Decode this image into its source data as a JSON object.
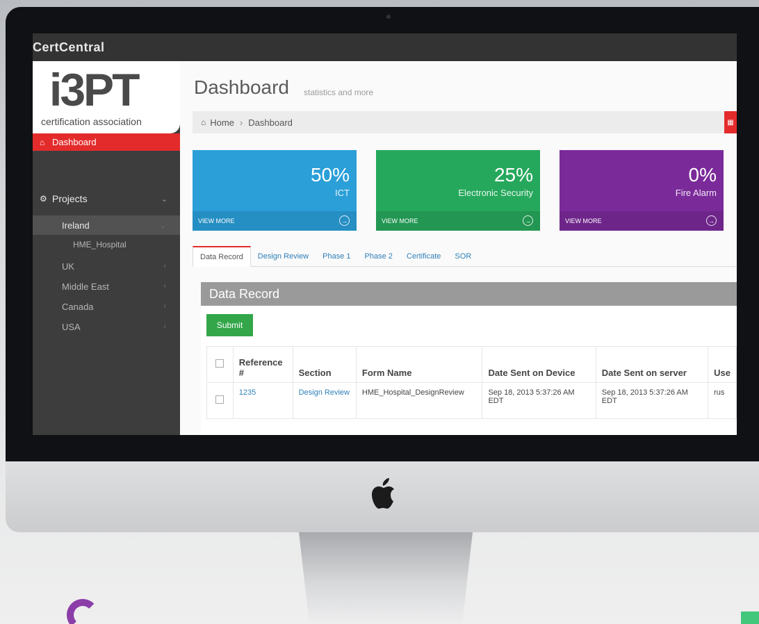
{
  "app": {
    "title": "CertCentral"
  },
  "logo": {
    "main": "i3PT",
    "sub": "certification association"
  },
  "sidebar": {
    "dashboard": {
      "label": "Dashboard",
      "icon": "home-icon"
    },
    "projects": {
      "label": "Projects",
      "icon": "gears-icon"
    },
    "regions": [
      {
        "label": "Ireland",
        "expanded": true,
        "children": [
          "HME_Hospital"
        ]
      },
      {
        "label": "UK"
      },
      {
        "label": "Middle East"
      },
      {
        "label": "Canada"
      },
      {
        "label": "USA"
      }
    ]
  },
  "header": {
    "title": "Dashboard",
    "subtitle": "statistics and more",
    "breadcrumb": [
      "Home",
      "Dashboard"
    ]
  },
  "stats": [
    {
      "value": "50%",
      "label": "ICT",
      "footer": "VIEW MORE",
      "color": "#2a9fd8"
    },
    {
      "value": "25%",
      "label": "Electronic Security",
      "footer": "VIEW MORE",
      "color": "#26a85c"
    },
    {
      "value": "0%",
      "label": "Fire Alarm",
      "footer": "VIEW MORE",
      "color": "#7b2a9a"
    }
  ],
  "tabs": [
    "Data Record",
    "Design Review",
    "Phase 1",
    "Phase 2",
    "Certificate",
    "SOR"
  ],
  "active_tab": "Data Record",
  "panel": {
    "title": "Data Record",
    "submit_label": "Submit",
    "columns": [
      "Reference #",
      "Section",
      "Form Name",
      "Date Sent on Device",
      "Date Sent on server",
      "Use"
    ],
    "rows": [
      {
        "reference": "1235",
        "section": "Design Review",
        "form_name": "HME_Hospital_DesignReview",
        "date_device": "Sep 18, 2013 5:37:26 AM EDT",
        "date_server": "Sep 18, 2013 5:37:26 AM EDT",
        "user": "rus"
      }
    ]
  },
  "colors": {
    "accent": "#e42b2b",
    "sidebar": "#3d3d3d",
    "topbar": "#333333"
  }
}
